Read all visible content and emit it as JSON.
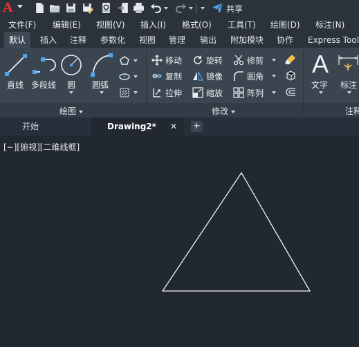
{
  "qat": {
    "share_label": "共享"
  },
  "menu": [
    "文件(F)",
    "编辑(E)",
    "视图(V)",
    "插入(I)",
    "格式(O)",
    "工具(T)",
    "绘图(D)",
    "标注(N)"
  ],
  "ribbon_tabs": [
    {
      "label": "默认",
      "active": true
    },
    {
      "label": "插入"
    },
    {
      "label": "注释"
    },
    {
      "label": "参数化"
    },
    {
      "label": "视图"
    },
    {
      "label": "管理"
    },
    {
      "label": "输出"
    },
    {
      "label": "附加模块"
    },
    {
      "label": "协作"
    },
    {
      "label": "Express Tools"
    }
  ],
  "draw_panel": {
    "title": "绘图",
    "line": "直线",
    "polyline": "多段线",
    "circle": "圆",
    "arc": "圆弧"
  },
  "modify_panel": {
    "title": "修改",
    "move": "移动",
    "rotate": "旋转",
    "trim": "修剪",
    "copy": "复制",
    "mirror": "镜像",
    "fillet": "圆角",
    "stretch": "拉伸",
    "scale": "缩放",
    "array": "阵列"
  },
  "annotation_panel": {
    "title": "注释",
    "text": "文字",
    "dimension": "标注"
  },
  "doc_tabs": {
    "start": "开始",
    "drawing": "Drawing2*",
    "close_glyph": "✕",
    "add_glyph": "+"
  },
  "viewport": {
    "label": "[−][俯视][二维线框]"
  },
  "colors": {
    "accent_red": "#e5322d",
    "share_blue": "#4fa6f0",
    "background": "#212830",
    "ribbon": "#3b4550"
  }
}
